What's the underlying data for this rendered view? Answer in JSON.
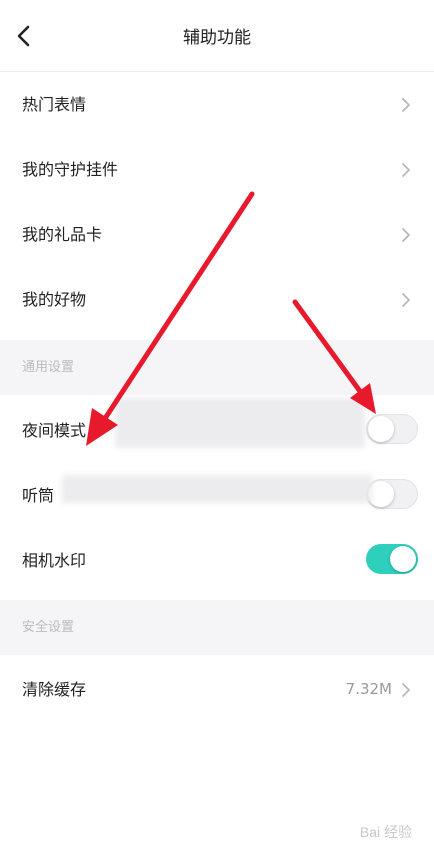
{
  "header": {
    "title": "辅助功能",
    "back_icon": "chevron-left-icon"
  },
  "menu_items": [
    {
      "label": "热门表情"
    },
    {
      "label": "我的守护挂件"
    },
    {
      "label": "我的礼品卡"
    },
    {
      "label": "我的好物"
    }
  ],
  "general_section": {
    "title": "通用设置",
    "items": [
      {
        "label": "夜间模式",
        "toggle": "off"
      },
      {
        "label": "听筒",
        "toggle": "off"
      },
      {
        "label": "相机水印",
        "toggle": "on"
      }
    ]
  },
  "security_section": {
    "title": "安全设置",
    "items": [
      {
        "label": "清除缓存",
        "value": "7.32M"
      }
    ]
  },
  "colors": {
    "toggle_on": "#2fcfbe",
    "annotation_arrow": "#e8192c"
  },
  "watermark": {
    "text": "Bai 经验"
  }
}
